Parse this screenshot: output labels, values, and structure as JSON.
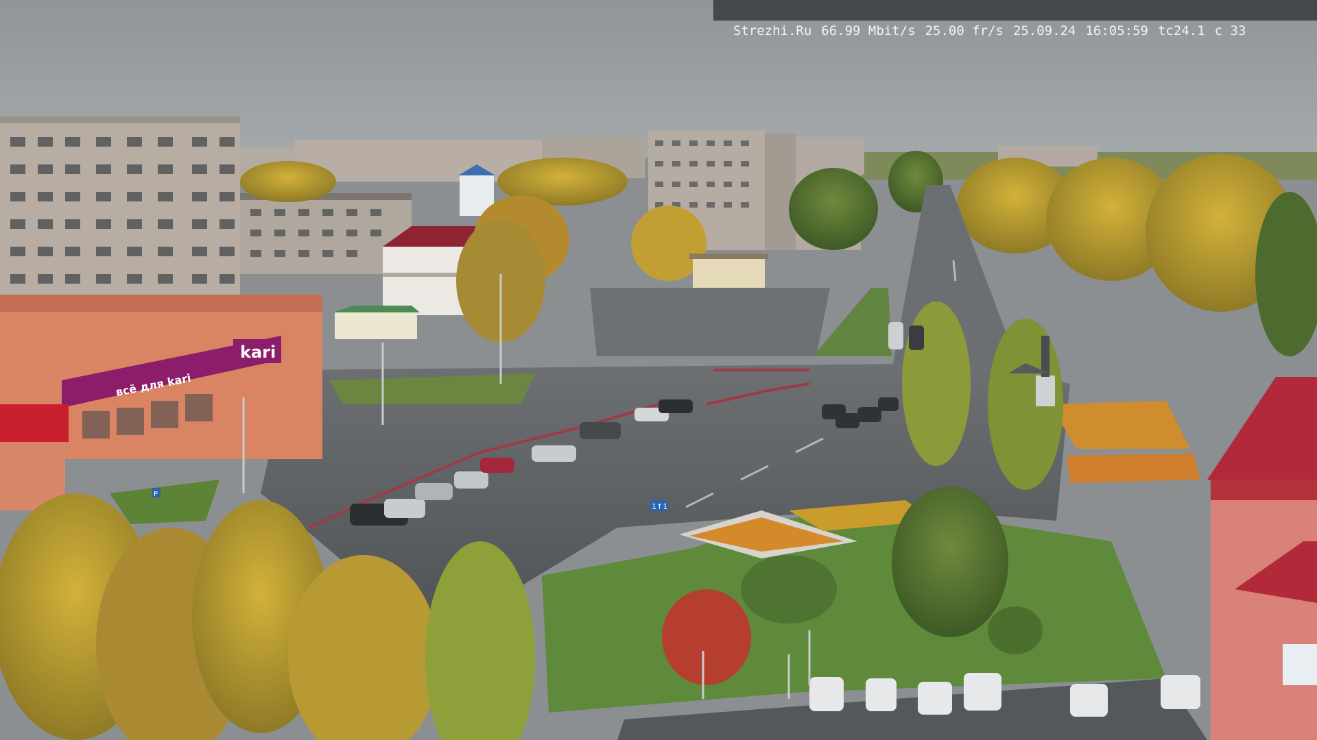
{
  "overlay": {
    "site": "Strezhi.Ru",
    "bitrate": "66.99 Mbit/s",
    "framerate": "25.00 fr/s",
    "date": "25.09.24",
    "time": "16:05:59",
    "camera": "tc24.1",
    "channel": "c 33"
  },
  "signs": {
    "store_main": "kari",
    "store_awning": "всё для kari",
    "bus_sign": "Р",
    "road_sign": "1↑1"
  },
  "colors": {
    "sky": "#9ba1a6",
    "asphalt": "#565a5d",
    "plaza": "#6b6e70",
    "grass": "#5d8a3a",
    "autumn_yellow": "#c7a42c",
    "brand_magenta": "#8c1d6a",
    "roof_red": "#b22a3a"
  }
}
